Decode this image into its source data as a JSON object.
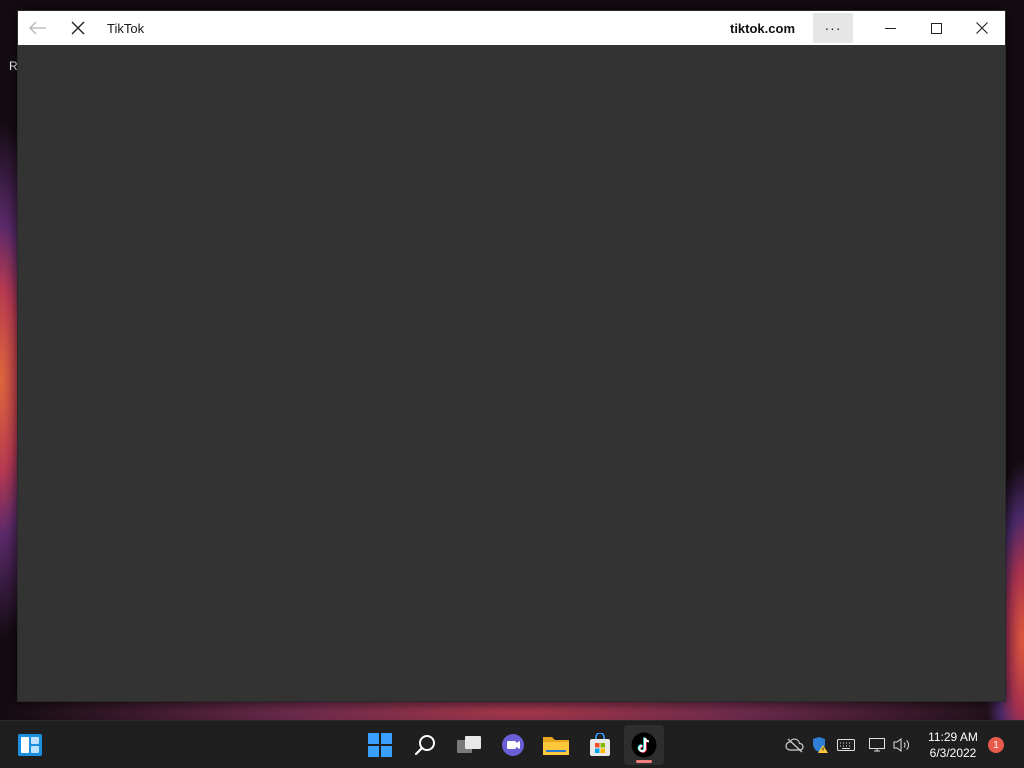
{
  "desktop": {
    "partial_label": "R"
  },
  "window": {
    "title": "TikTok",
    "domain": "tiktok.com",
    "more_label": "···",
    "background": "#333333"
  },
  "taskbar": {
    "pinned_apps": [
      {
        "name": "Widgets",
        "icon": "widgets-icon"
      },
      {
        "name": "Start",
        "icon": "windows-start-icon"
      },
      {
        "name": "Search",
        "icon": "search-icon"
      },
      {
        "name": "Task View",
        "icon": "task-view-icon"
      },
      {
        "name": "Chat",
        "icon": "chat-icon"
      },
      {
        "name": "File Explorer",
        "icon": "folder-icon"
      },
      {
        "name": "Microsoft Store",
        "icon": "store-icon"
      },
      {
        "name": "TikTok",
        "icon": "tiktok-icon",
        "active": true
      }
    ],
    "tray": {
      "icons": [
        "cloud-offline-icon",
        "security-warning-icon",
        "keyboard-icon",
        "network-icon",
        "volume-icon"
      ],
      "time": "11:29 AM",
      "date": "6/3/2022",
      "notification_count": "1"
    }
  },
  "colors": {
    "accent_blue": "#0078d4",
    "taskbar_bg": "#1f1f1f",
    "notification": "#e85a4a",
    "tiktok_indicator": "#f08080"
  }
}
